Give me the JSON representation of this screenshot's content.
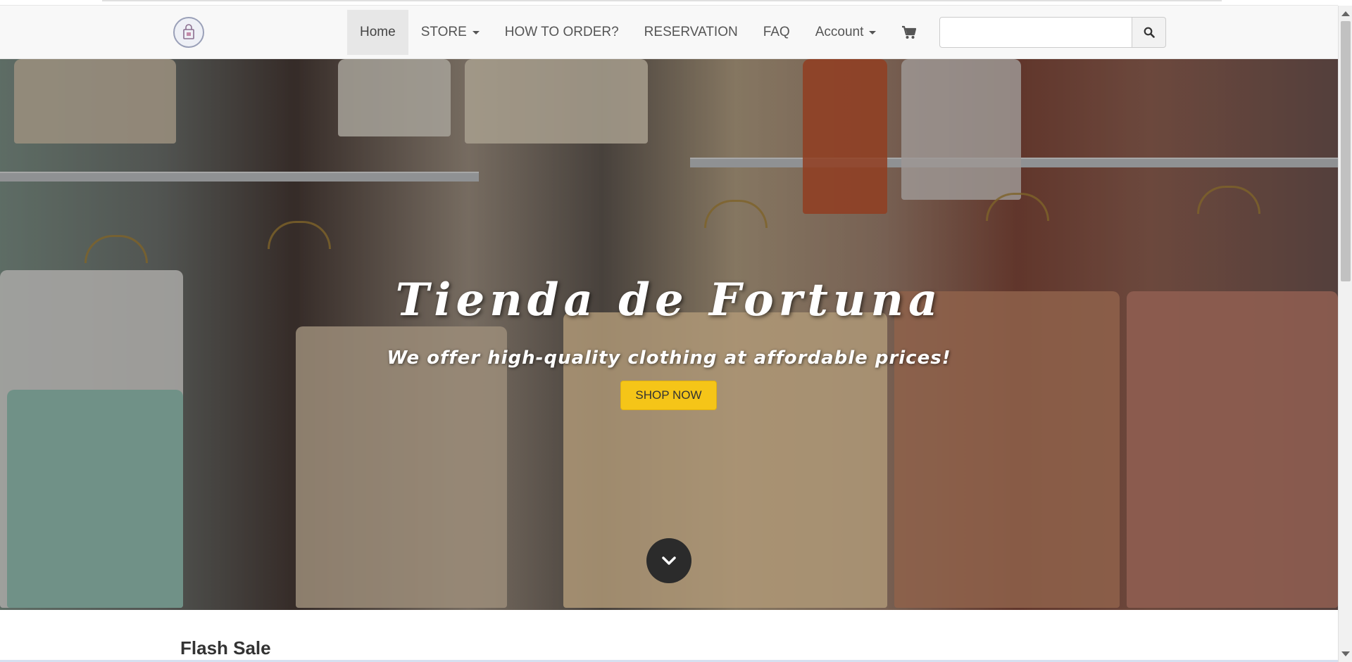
{
  "nav": {
    "logo_icon": "shop-logo-icon",
    "items": [
      {
        "label": "Home",
        "active": true
      },
      {
        "label": "STORE",
        "dropdown": true
      },
      {
        "label": "HOW TO ORDER?"
      },
      {
        "label": "RESERVATION"
      },
      {
        "label": "FAQ"
      },
      {
        "label": "Account",
        "dropdown": true
      }
    ],
    "cart_icon": "cart-icon"
  },
  "search": {
    "value": "",
    "placeholder": "",
    "icon": "search-icon"
  },
  "hero": {
    "title": "Tienda de Fortuna",
    "subtitle": "We offer high-quality clothing at affordable prices!",
    "cta_label": "SHOP NOW",
    "cta_color": "#f5c518",
    "scroll_icon": "chevron-down-icon"
  },
  "flash": {
    "title": "Flash Sale"
  }
}
